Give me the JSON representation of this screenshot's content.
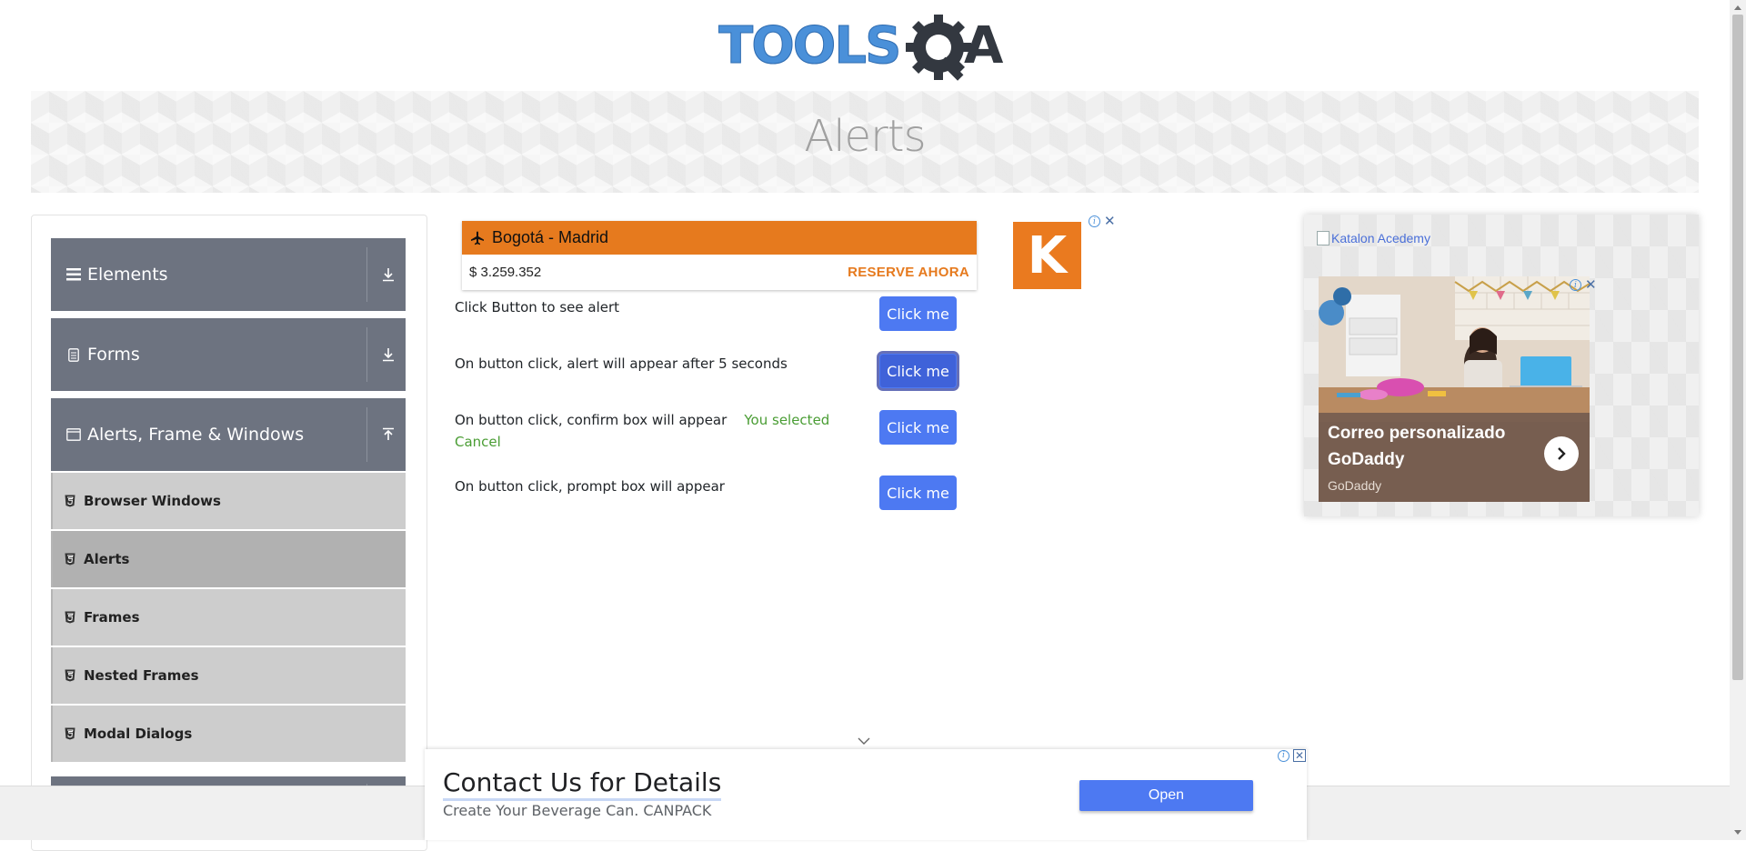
{
  "brand": {
    "logo_text": "TOOLSQA",
    "colors": {
      "logo_blue": "#4a90d9",
      "logo_dark": "#333840"
    }
  },
  "page": {
    "title": "Alerts"
  },
  "sidebar": {
    "groups": [
      {
        "label": "Elements",
        "icon": "hamburger-icon",
        "arrow": "download-icon"
      },
      {
        "label": "Forms",
        "icon": "form-icon",
        "arrow": "download-icon"
      },
      {
        "label": "Alerts, Frame & Windows",
        "icon": "window-icon",
        "arrow": "upload-icon"
      }
    ],
    "items": [
      {
        "label": "Browser Windows",
        "active": false
      },
      {
        "label": "Alerts",
        "active": true
      },
      {
        "label": "Frames",
        "active": false
      },
      {
        "label": "Nested Frames",
        "active": false
      },
      {
        "label": "Modal Dialogs",
        "active": false
      }
    ]
  },
  "flight_ad": {
    "route": "Bogotá - Madrid",
    "price": "$ 3.259.352",
    "cta": "RESERVE AHORA",
    "color": "#e67a1e"
  },
  "k_ad": {
    "letter": "K"
  },
  "alerts": {
    "rows": [
      {
        "text": "Click Button to see alert",
        "button": "Click me"
      },
      {
        "text": "On button click, alert will appear after 5 seconds",
        "button": "Click me"
      },
      {
        "text": "On button click, confirm box will appear",
        "result": "You selected Cancel",
        "button": "Click me"
      },
      {
        "text": "On button click, prompt box will appear",
        "button": "Click me"
      }
    ],
    "button_color": "#4d79f2",
    "result_color": "#4a9d34"
  },
  "right_ad": {
    "link_text": "Katalon Acedemy",
    "headline": "Correo personalizado GoDaddy",
    "advertiser": "GoDaddy"
  },
  "bottom_ad": {
    "title": "Contact Us for Details",
    "subtitle": "Create Your Beverage Can. CANPACK",
    "button": "Open"
  }
}
